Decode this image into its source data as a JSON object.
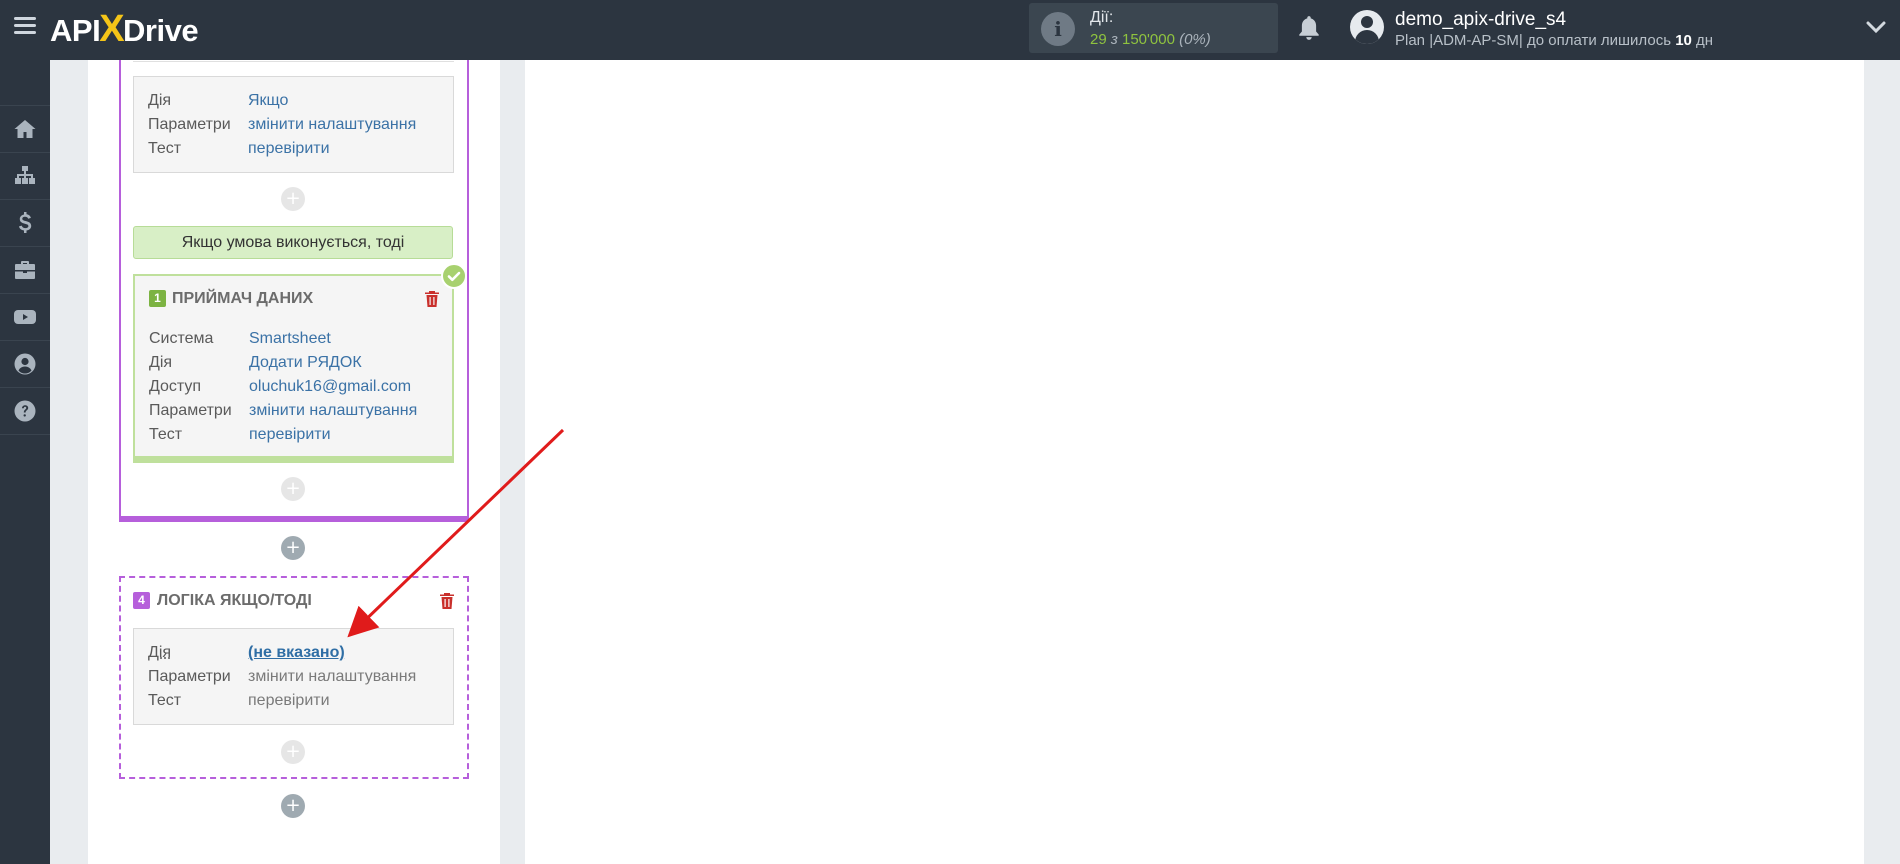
{
  "app": {
    "logo_part1": "API",
    "logo_x": "X",
    "logo_part2": "Drive"
  },
  "header": {
    "actions_label": "Дії:",
    "actions_used": "29",
    "actions_sep": " з ",
    "actions_total": "150'000",
    "actions_percent": "(0%)",
    "user_name": "demo_apix-drive_s4",
    "plan_text": "Plan |ADM-AP-SM| до оплати лишилось ",
    "plan_days": "10",
    "plan_unit": " дн"
  },
  "sidebar": {
    "items": [
      {
        "icon": "home-icon"
      },
      {
        "icon": "sitemap-icon"
      },
      {
        "icon": "dollar-icon"
      },
      {
        "icon": "briefcase-icon"
      },
      {
        "icon": "youtube-icon"
      },
      {
        "icon": "user-circle-icon"
      },
      {
        "icon": "help-icon"
      }
    ]
  },
  "filter_card": {
    "rows": [
      {
        "key": "Дія",
        "value": "Якщо"
      },
      {
        "key": "Параметри",
        "value": "змінити налаштування"
      },
      {
        "key": "Тест",
        "value": "перевірити"
      }
    ]
  },
  "condition_banner": "Якщо умова виконується, тоді",
  "receiver": {
    "number": "1",
    "title": "ПРИЙМАЧ ДАНИХ",
    "rows": [
      {
        "key": "Система",
        "value": "Smartsheet"
      },
      {
        "key": "Дія",
        "value": "Додати РЯДОК"
      },
      {
        "key": "Доступ",
        "value": "oluchuk16@gmail.com"
      },
      {
        "key": "Параметри",
        "value": "змінити налаштування"
      },
      {
        "key": "Тест",
        "value": "перевірити"
      }
    ]
  },
  "logic": {
    "number": "4",
    "title": "ЛОГІКА ЯКЩО/ТОДІ",
    "rows": [
      {
        "key": "Дія",
        "value": "(не вказано)"
      },
      {
        "key": "Параметри",
        "value": "змінити налаштування"
      },
      {
        "key": "Тест",
        "value": "перевірити"
      }
    ]
  },
  "plus_symbol": "+",
  "colors": {
    "topbar": "#2c3540",
    "accent_purple": "#b65fdb",
    "accent_green": "#8fc33f",
    "link_blue": "#3b72a6",
    "trash_red": "#c9302c",
    "arrow_red": "#e01b1b"
  }
}
